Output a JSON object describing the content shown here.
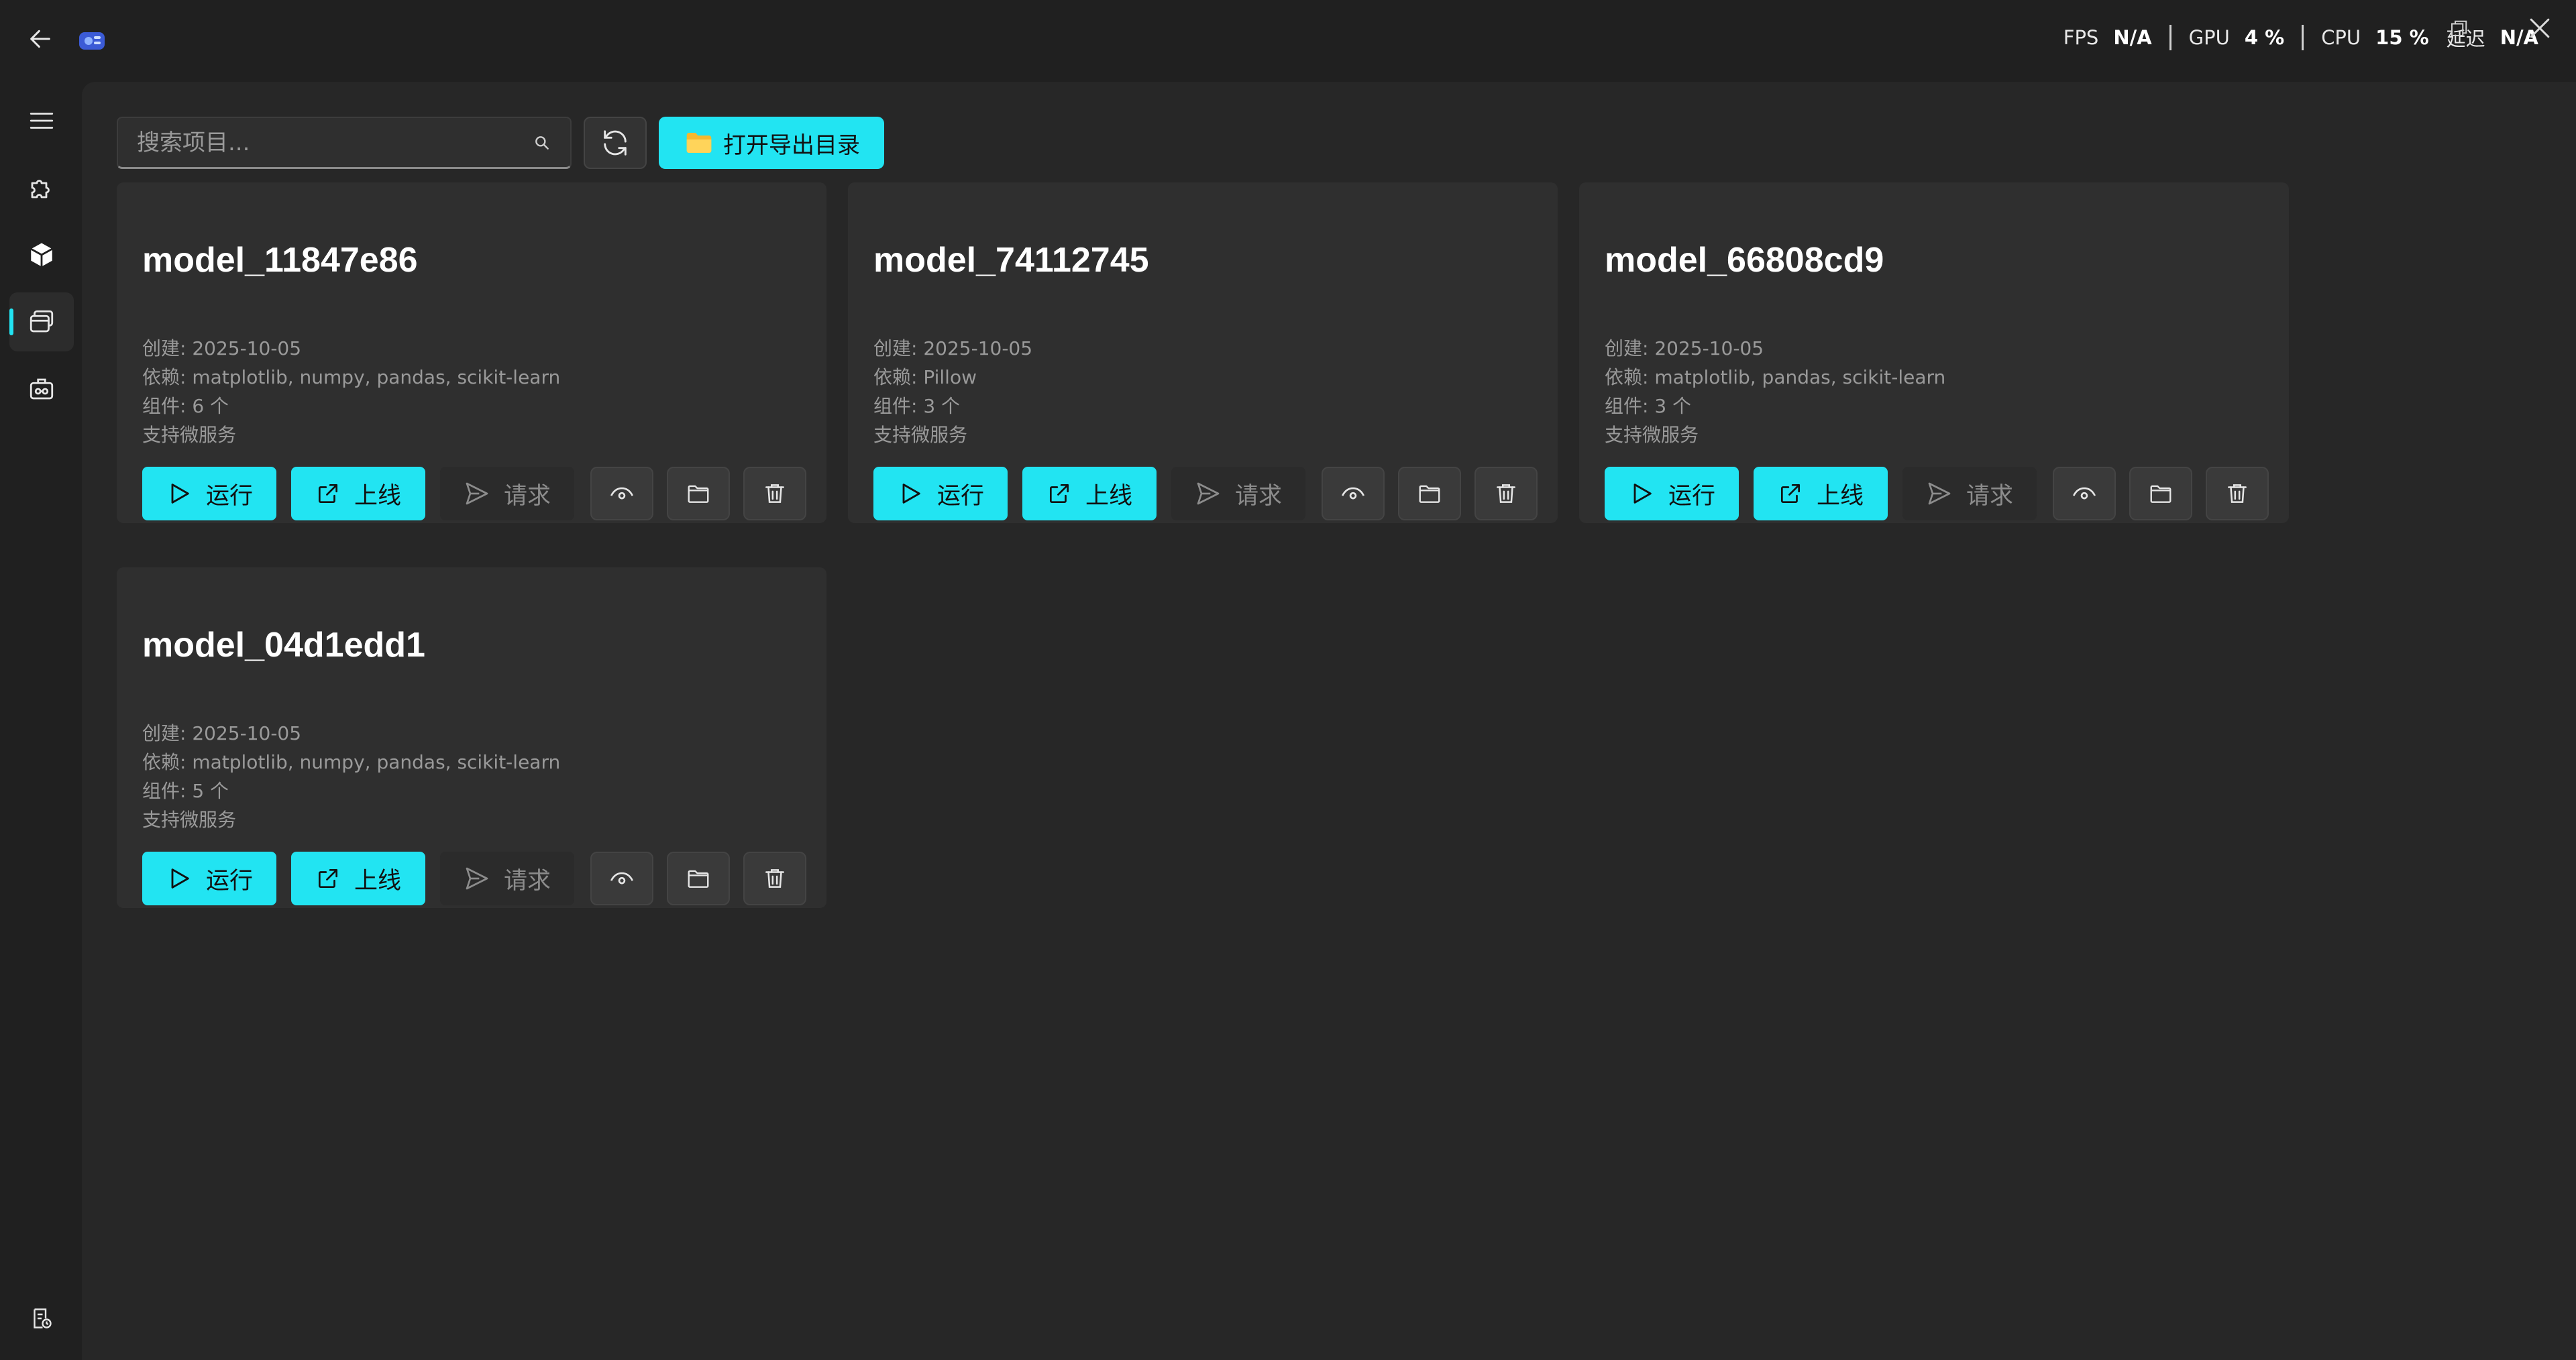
{
  "header": {
    "back_icon": "arrow-left-icon",
    "logo_icon": "app-logo-icon",
    "metrics": [
      {
        "label": "FPS",
        "value": "N/A"
      },
      {
        "label": "GPU",
        "value": "4 %"
      },
      {
        "label": "CPU",
        "value": "15 %"
      },
      {
        "label": "延迟",
        "value": "N/A"
      }
    ]
  },
  "sidebar": {
    "items": [
      {
        "name": "menu",
        "icon": "hamburger-menu-icon",
        "active": false
      },
      {
        "name": "plugins",
        "icon": "puzzle-icon",
        "active": false
      },
      {
        "name": "models",
        "icon": "cube-icon",
        "active": false
      },
      {
        "name": "projects",
        "icon": "window-stack-icon",
        "active": true
      },
      {
        "name": "toolbox",
        "icon": "toolbox-icon",
        "active": false
      }
    ],
    "bottom_icon": "log-history-icon"
  },
  "toolbar": {
    "search_placeholder": "搜索项目...",
    "open_export_label": "打开导出目录"
  },
  "projects": [
    {
      "name": "model_11847e86",
      "created": "创建: 2025-10-05",
      "deps": "依赖: matplotlib, numpy, pandas, scikit-learn",
      "components": "组件: 6 个",
      "microservice": "支持微服务"
    },
    {
      "name": "model_74112745",
      "created": "创建: 2025-10-05",
      "deps": "依赖: Pillow",
      "components": "组件: 3 个",
      "microservice": "支持微服务"
    },
    {
      "name": "model_66808cd9",
      "created": "创建: 2025-10-05",
      "deps": "依赖: matplotlib, pandas, scikit-learn",
      "components": "组件: 3 个",
      "microservice": "支持微服务"
    },
    {
      "name": "model_04d1edd1",
      "created": "创建: 2025-10-05",
      "deps": "依赖: matplotlib, numpy, pandas, scikit-learn",
      "components": "组件: 5 个",
      "microservice": "支持微服务"
    }
  ],
  "card_actions": {
    "run_label": "运行",
    "deploy_label": "上线",
    "request_label": "请求"
  },
  "colors": {
    "accent": "#22e4f2",
    "background": "#202020",
    "panel": "#272727",
    "card": "#2f2f2f"
  }
}
